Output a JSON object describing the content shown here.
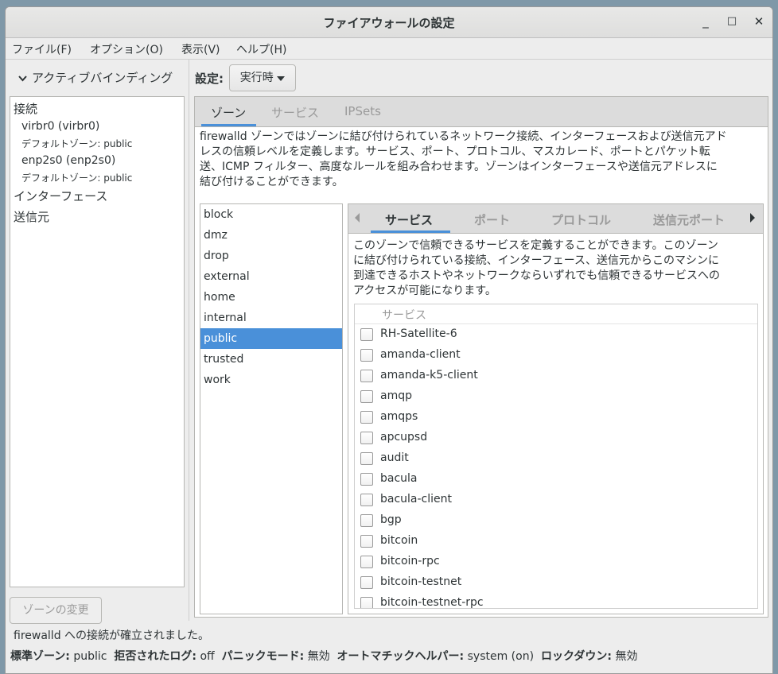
{
  "window": {
    "title": "ファイアウォールの設定",
    "minimize": "_",
    "maximize": "□",
    "close": "✕"
  },
  "menu": [
    "ファイル(F)",
    "オプション(O)",
    "表示(V)",
    "ヘルプ(H)"
  ],
  "left": {
    "active_bindings_label": "アクティブバインディング",
    "connections_header": "接続",
    "connections": [
      {
        "name": "virbr0 (virbr0)",
        "zone": "デフォルトゾーン: public"
      },
      {
        "name": "enp2s0 (enp2s0)",
        "zone": "デフォルトゾーン: public"
      }
    ],
    "interfaces_header": "インターフェース",
    "sources_header": "送信元",
    "change_zone_button": "ゾーンの変更"
  },
  "config": {
    "label": "設定:",
    "value": "実行時"
  },
  "tabs": [
    "ゾーン",
    "サービス",
    "IPSets"
  ],
  "zone_description": [
    "firewalld ゾーンではゾーンに結び付けられているネットワーク接続、インターフェースおよび送信元アド",
    "レスの信頼レベルを定義します。サービス、ポート、プロトコル、マスカレード、ポートとパケット転",
    "送、ICMP フィルター、高度なルールを組み合わせます。ゾーンはインターフェースや送信元アドレスに",
    "結び付けることができます。"
  ],
  "zones": [
    "block",
    "dmz",
    "drop",
    "external",
    "home",
    "internal",
    "public",
    "trusted",
    "work"
  ],
  "selected_zone": "public",
  "subtabs": [
    "サービス",
    "ポート",
    "プロトコル",
    "送信元ポート"
  ],
  "service_description": [
    "このゾーンで信頼できるサービスを定義することができます。このゾーン",
    "に結び付けられている接続、インターフェース、送信元からこのマシンに",
    "到達できるホストやネットワークならいずれでも信頼できるサービスへの",
    "アクセスが可能になります。"
  ],
  "service_column": "サービス",
  "services": [
    "RH-Satellite-6",
    "amanda-client",
    "amanda-k5-client",
    "amqp",
    "amqps",
    "apcupsd",
    "audit",
    "bacula",
    "bacula-client",
    "bgp",
    "bitcoin",
    "bitcoin-rpc",
    "bitcoin-testnet",
    "bitcoin-testnet-rpc"
  ],
  "status": {
    "message": "firewalld への接続が確立されました。",
    "default_zone_label": "標準ゾーン:",
    "default_zone": "public",
    "denied_log_label": "拒否されたログ:",
    "denied_log": "off",
    "panic_label": "パニックモード:",
    "panic": "無効",
    "helper_label": "オートマチックヘルパー:",
    "helper": "system (on)",
    "lockdown_label": "ロックダウン:",
    "lockdown": "無効"
  },
  "colors": {
    "accent": "#4a90d9",
    "window_bg": "#ededed",
    "desktop_bg": "#7f98a8"
  }
}
